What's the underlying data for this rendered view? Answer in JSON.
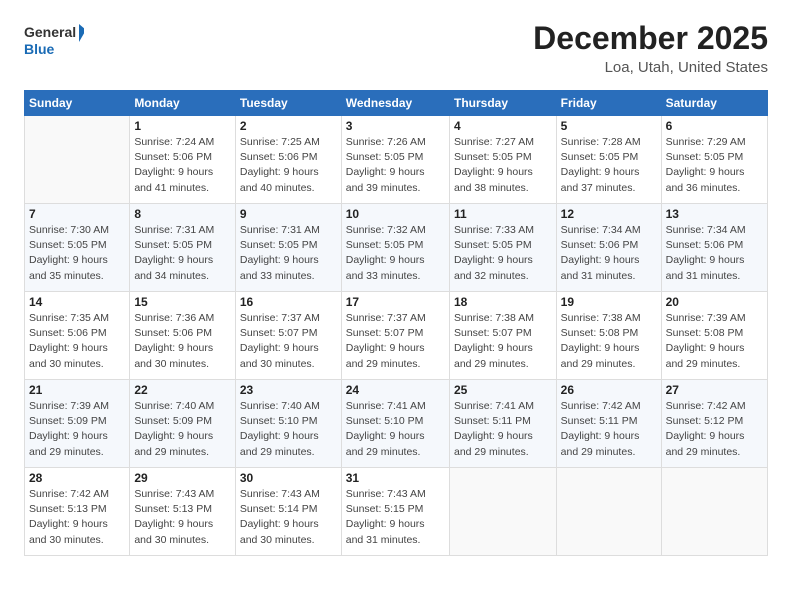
{
  "logo": {
    "line1": "General",
    "line2": "Blue"
  },
  "title": "December 2025",
  "subtitle": "Loa, Utah, United States",
  "days_of_week": [
    "Sunday",
    "Monday",
    "Tuesday",
    "Wednesday",
    "Thursday",
    "Friday",
    "Saturday"
  ],
  "weeks": [
    [
      {
        "num": "",
        "info": ""
      },
      {
        "num": "1",
        "info": "Sunrise: 7:24 AM\nSunset: 5:06 PM\nDaylight: 9 hours\nand 41 minutes."
      },
      {
        "num": "2",
        "info": "Sunrise: 7:25 AM\nSunset: 5:06 PM\nDaylight: 9 hours\nand 40 minutes."
      },
      {
        "num": "3",
        "info": "Sunrise: 7:26 AM\nSunset: 5:05 PM\nDaylight: 9 hours\nand 39 minutes."
      },
      {
        "num": "4",
        "info": "Sunrise: 7:27 AM\nSunset: 5:05 PM\nDaylight: 9 hours\nand 38 minutes."
      },
      {
        "num": "5",
        "info": "Sunrise: 7:28 AM\nSunset: 5:05 PM\nDaylight: 9 hours\nand 37 minutes."
      },
      {
        "num": "6",
        "info": "Sunrise: 7:29 AM\nSunset: 5:05 PM\nDaylight: 9 hours\nand 36 minutes."
      }
    ],
    [
      {
        "num": "7",
        "info": "Sunrise: 7:30 AM\nSunset: 5:05 PM\nDaylight: 9 hours\nand 35 minutes."
      },
      {
        "num": "8",
        "info": "Sunrise: 7:31 AM\nSunset: 5:05 PM\nDaylight: 9 hours\nand 34 minutes."
      },
      {
        "num": "9",
        "info": "Sunrise: 7:31 AM\nSunset: 5:05 PM\nDaylight: 9 hours\nand 33 minutes."
      },
      {
        "num": "10",
        "info": "Sunrise: 7:32 AM\nSunset: 5:05 PM\nDaylight: 9 hours\nand 33 minutes."
      },
      {
        "num": "11",
        "info": "Sunrise: 7:33 AM\nSunset: 5:05 PM\nDaylight: 9 hours\nand 32 minutes."
      },
      {
        "num": "12",
        "info": "Sunrise: 7:34 AM\nSunset: 5:06 PM\nDaylight: 9 hours\nand 31 minutes."
      },
      {
        "num": "13",
        "info": "Sunrise: 7:34 AM\nSunset: 5:06 PM\nDaylight: 9 hours\nand 31 minutes."
      }
    ],
    [
      {
        "num": "14",
        "info": "Sunrise: 7:35 AM\nSunset: 5:06 PM\nDaylight: 9 hours\nand 30 minutes."
      },
      {
        "num": "15",
        "info": "Sunrise: 7:36 AM\nSunset: 5:06 PM\nDaylight: 9 hours\nand 30 minutes."
      },
      {
        "num": "16",
        "info": "Sunrise: 7:37 AM\nSunset: 5:07 PM\nDaylight: 9 hours\nand 30 minutes."
      },
      {
        "num": "17",
        "info": "Sunrise: 7:37 AM\nSunset: 5:07 PM\nDaylight: 9 hours\nand 29 minutes."
      },
      {
        "num": "18",
        "info": "Sunrise: 7:38 AM\nSunset: 5:07 PM\nDaylight: 9 hours\nand 29 minutes."
      },
      {
        "num": "19",
        "info": "Sunrise: 7:38 AM\nSunset: 5:08 PM\nDaylight: 9 hours\nand 29 minutes."
      },
      {
        "num": "20",
        "info": "Sunrise: 7:39 AM\nSunset: 5:08 PM\nDaylight: 9 hours\nand 29 minutes."
      }
    ],
    [
      {
        "num": "21",
        "info": "Sunrise: 7:39 AM\nSunset: 5:09 PM\nDaylight: 9 hours\nand 29 minutes."
      },
      {
        "num": "22",
        "info": "Sunrise: 7:40 AM\nSunset: 5:09 PM\nDaylight: 9 hours\nand 29 minutes."
      },
      {
        "num": "23",
        "info": "Sunrise: 7:40 AM\nSunset: 5:10 PM\nDaylight: 9 hours\nand 29 minutes."
      },
      {
        "num": "24",
        "info": "Sunrise: 7:41 AM\nSunset: 5:10 PM\nDaylight: 9 hours\nand 29 minutes."
      },
      {
        "num": "25",
        "info": "Sunrise: 7:41 AM\nSunset: 5:11 PM\nDaylight: 9 hours\nand 29 minutes."
      },
      {
        "num": "26",
        "info": "Sunrise: 7:42 AM\nSunset: 5:11 PM\nDaylight: 9 hours\nand 29 minutes."
      },
      {
        "num": "27",
        "info": "Sunrise: 7:42 AM\nSunset: 5:12 PM\nDaylight: 9 hours\nand 29 minutes."
      }
    ],
    [
      {
        "num": "28",
        "info": "Sunrise: 7:42 AM\nSunset: 5:13 PM\nDaylight: 9 hours\nand 30 minutes."
      },
      {
        "num": "29",
        "info": "Sunrise: 7:43 AM\nSunset: 5:13 PM\nDaylight: 9 hours\nand 30 minutes."
      },
      {
        "num": "30",
        "info": "Sunrise: 7:43 AM\nSunset: 5:14 PM\nDaylight: 9 hours\nand 30 minutes."
      },
      {
        "num": "31",
        "info": "Sunrise: 7:43 AM\nSunset: 5:15 PM\nDaylight: 9 hours\nand 31 minutes."
      },
      {
        "num": "",
        "info": ""
      },
      {
        "num": "",
        "info": ""
      },
      {
        "num": "",
        "info": ""
      }
    ]
  ]
}
